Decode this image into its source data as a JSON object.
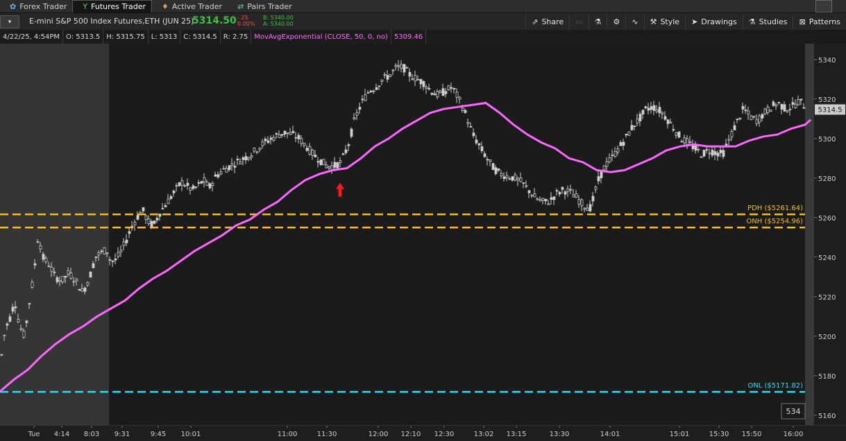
{
  "tabs": [
    {
      "label": "Forex Trader",
      "icon": "forex-icon"
    },
    {
      "label": "Futures Trader",
      "icon": "futures-icon",
      "active": true
    },
    {
      "label": "Active Trader",
      "icon": "active-trader-icon"
    },
    {
      "label": "Pairs Trader",
      "icon": "pairs-icon"
    }
  ],
  "symbol": {
    "name": "E-mini S&P 500 Index Futures,ETH (JUN 25)",
    "last": "5314.50",
    "change": "-.25",
    "change_pct": "0.00%",
    "bid": "B: 5340.00",
    "ask": "A: 5340.00"
  },
  "toolbar": {
    "share": "Share",
    "style": "Style",
    "drawings": "Drawings",
    "studies": "Studies",
    "patterns": "Patterns"
  },
  "info": {
    "datetime": "4/22/25, 4:54PM",
    "open": "O: 5313.5",
    "high": "H: 5315.75",
    "low": "L: 5313",
    "close": "C: 5314.5",
    "range": "R: 2.75",
    "ma_label": "MovAvgExponential (CLOSE, 50, 0, no)",
    "ma_value": "5309.46"
  },
  "colors": {
    "ma": "#ff66ff",
    "level_gold": "#f2c018",
    "level_cyan": "#25e0ee",
    "candle": "#cfcfcf",
    "arrow": "#ff1a1a"
  },
  "levels": [
    {
      "label": "PDH ($5261.64)",
      "value": 5261.64,
      "color": "#f2c018"
    },
    {
      "label": "ONH ($5254.96)",
      "value": 5254.96,
      "color": "#f2c018"
    },
    {
      "label": "ONL ($5171.82)",
      "value": 5171.82,
      "color": "#25e0ee"
    }
  ],
  "y_ticks": [
    5340,
    5320,
    5300,
    5280,
    5260,
    5240,
    5220,
    5200,
    5180,
    5160
  ],
  "current_price_label": "5314.5",
  "bar_count": "534",
  "x_ticks": [
    "Tue",
    "4:14",
    "8:03",
    "9:31",
    "9:45",
    "10:01",
    "11:00",
    "11:30",
    "12:00",
    "12:10",
    "12:30",
    "13:02",
    "13:15",
    "13:30",
    "14:01",
    "15:01",
    "15:30",
    "15:50",
    "16:00"
  ],
  "chart_data": {
    "type": "line",
    "y_range": [
      5155,
      5348
    ],
    "series": [
      {
        "name": "price",
        "x": [
          0,
          2,
          8,
          14,
          20,
          27,
          34,
          40,
          47,
          54,
          60,
          70,
          78,
          88,
          98,
          108,
          118,
          128,
          136,
          144,
          152,
          158,
          164,
          172,
          180,
          188,
          196,
          204,
          212,
          220,
          228,
          236,
          244,
          252,
          260,
          268,
          276,
          284,
          292,
          300,
          310,
          320,
          330,
          340,
          350,
          360,
          370,
          380,
          390,
          400,
          410,
          420,
          430,
          440,
          450,
          460,
          470,
          480,
          490,
          500,
          510,
          520,
          530,
          540,
          550,
          560,
          570,
          580,
          590,
          600,
          610,
          620,
          630,
          640,
          650,
          660,
          670,
          680,
          690,
          700,
          710,
          720,
          730,
          740,
          750,
          760,
          770,
          780,
          790,
          800,
          810,
          820,
          830,
          840,
          850,
          860,
          870,
          880,
          890,
          900,
          910,
          920,
          930,
          940,
          950,
          960,
          970,
          980,
          990,
          1000,
          1010,
          1020,
          1030,
          1040,
          1050,
          1060,
          1070,
          1080,
          1090,
          1100,
          1110,
          1120,
          1130,
          1140,
          1150,
          1160,
          1168
        ],
        "y": [
          5185,
          5196,
          5205,
          5210,
          5218,
          5205,
          5200,
          5215,
          5230,
          5252,
          5240,
          5236,
          5230,
          5228,
          5232,
          5228,
          5222,
          5230,
          5240,
          5242,
          5244,
          5238,
          5238,
          5242,
          5248,
          5255,
          5260,
          5264,
          5258,
          5256,
          5262,
          5266,
          5270,
          5274,
          5278,
          5276,
          5274,
          5276,
          5279,
          5275,
          5281,
          5284,
          5286,
          5288,
          5290,
          5292,
          5295,
          5298,
          5300,
          5302,
          5303,
          5302,
          5300,
          5296,
          5292,
          5289,
          5286,
          5286,
          5288,
          5296,
          5310,
          5318,
          5324,
          5326,
          5330,
          5332,
          5336,
          5336,
          5332,
          5330,
          5328,
          5324,
          5322,
          5324,
          5326,
          5320,
          5312,
          5302,
          5296,
          5290,
          5285,
          5282,
          5281,
          5280,
          5278,
          5274,
          5270,
          5268,
          5268,
          5272,
          5274,
          5273,
          5270,
          5266,
          5265,
          5278,
          5286,
          5290,
          5295,
          5300,
          5306,
          5310,
          5315,
          5316,
          5314,
          5310,
          5305,
          5300,
          5298,
          5295,
          5292,
          5294,
          5293,
          5292,
          5300,
          5308,
          5315,
          5311,
          5309,
          5313,
          5316,
          5318,
          5315,
          5316,
          5319,
          5316,
          5314.5
        ]
      },
      {
        "name": "MovAvgExponential (CLOSE, 50, 0, no)",
        "x": [
          0,
          20,
          40,
          60,
          80,
          100,
          120,
          140,
          160,
          180,
          200,
          220,
          240,
          260,
          280,
          300,
          320,
          340,
          360,
          380,
          400,
          420,
          440,
          460,
          480,
          500,
          520,
          540,
          560,
          580,
          600,
          620,
          640,
          660,
          680,
          700,
          720,
          740,
          760,
          780,
          800,
          820,
          840,
          860,
          880,
          900,
          920,
          940,
          960,
          980,
          1000,
          1020,
          1040,
          1060,
          1080,
          1100,
          1120,
          1140,
          1160,
          1168
        ],
        "y": [
          5172,
          5178,
          5183,
          5190,
          5196,
          5201,
          5205,
          5210,
          5214,
          5218,
          5224,
          5229,
          5233,
          5238,
          5243,
          5247,
          5251,
          5256,
          5259,
          5264,
          5268,
          5274,
          5279,
          5282,
          5284,
          5285,
          5290,
          5296,
          5300,
          5305,
          5309,
          5313,
          5315,
          5316,
          5317,
          5318,
          5313,
          5307,
          5302,
          5298,
          5295,
          5290,
          5288,
          5284,
          5283,
          5284,
          5287,
          5290,
          5294,
          5296,
          5297,
          5296,
          5296,
          5296,
          5299,
          5301,
          5302,
          5305,
          5307,
          5309.5
        ]
      }
    ],
    "annotations": [
      {
        "type": "arrow-up",
        "x": 490,
        "y": 5279,
        "color": "#ff1a1a"
      }
    ]
  }
}
